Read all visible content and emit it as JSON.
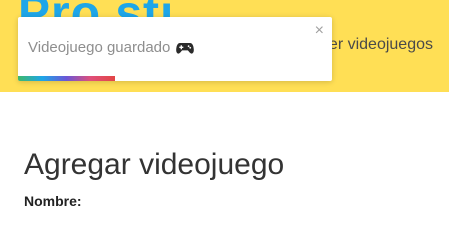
{
  "header": {
    "brand": "Pro.sti",
    "nav_link": "Ver videojuegos",
    "background_color": "#ffdf55",
    "brand_color": "#1ea6e8"
  },
  "toast": {
    "message": "Videojuego guardado",
    "icon": "gamepad-icon",
    "close": "×",
    "progress": 0.31
  },
  "main": {
    "title": "Agregar videojuego",
    "field_label": "Nombre:"
  }
}
